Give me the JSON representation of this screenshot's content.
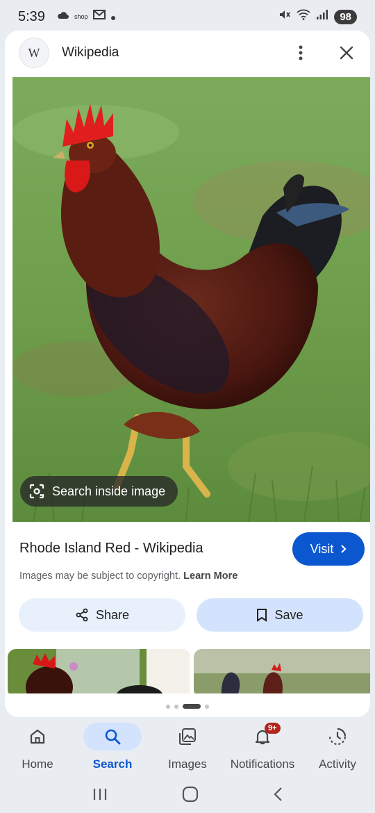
{
  "status_bar": {
    "time": "5:39",
    "shop_label": "shop",
    "battery": "98"
  },
  "header": {
    "logo_letter": "W",
    "site_name": "Wikipedia"
  },
  "image": {
    "search_inside_label": "Search inside image"
  },
  "result": {
    "title": "Rhode Island Red - Wikipedia",
    "visit_label": "Visit",
    "copyright_text": "Images may be subject to copyright.",
    "learn_more": "Learn More"
  },
  "actions": {
    "share_label": "Share",
    "save_label": "Save"
  },
  "pagination": {
    "count": 4,
    "active_index": 2
  },
  "bottom_nav": {
    "items": [
      {
        "label": "Home",
        "icon": "home-icon"
      },
      {
        "label": "Search",
        "icon": "search-icon",
        "active": true
      },
      {
        "label": "Images",
        "icon": "images-icon"
      },
      {
        "label": "Notifications",
        "icon": "bell-icon",
        "badge": "9+"
      },
      {
        "label": "Activity",
        "icon": "activity-icon"
      }
    ]
  },
  "colors": {
    "accent": "#0b57d0",
    "chip": "#d3e3fd",
    "badge": "#b3261e"
  }
}
